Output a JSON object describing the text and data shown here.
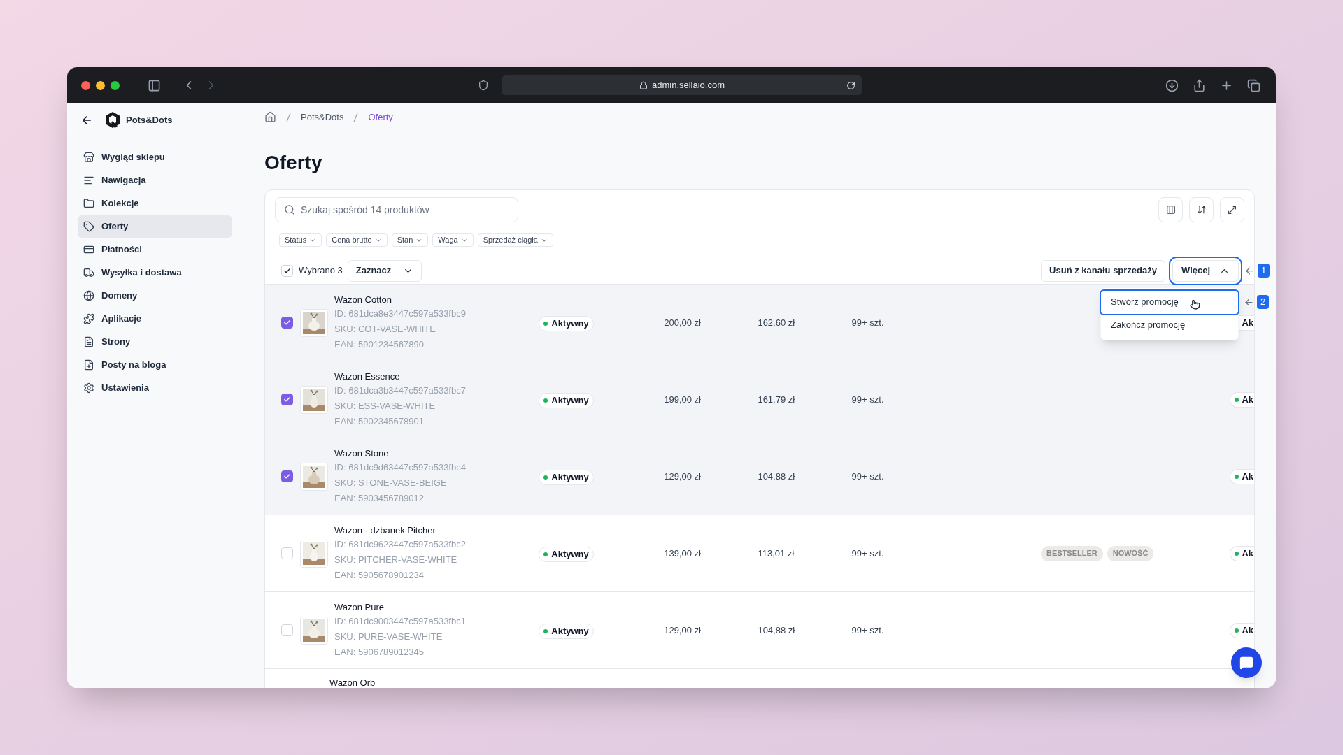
{
  "browser": {
    "url": "admin.sellaio.com"
  },
  "sidebar": {
    "store_name": "Pots&Dots",
    "items": [
      {
        "label": "Wygląd sklepu",
        "selected": false
      },
      {
        "label": "Nawigacja",
        "selected": false
      },
      {
        "label": "Kolekcje",
        "selected": false
      },
      {
        "label": "Oferty",
        "selected": true
      },
      {
        "label": "Płatności",
        "selected": false
      },
      {
        "label": "Wysyłka i dostawa",
        "selected": false
      },
      {
        "label": "Domeny",
        "selected": false
      },
      {
        "label": "Aplikacje",
        "selected": false
      },
      {
        "label": "Strony",
        "selected": false
      },
      {
        "label": "Posty na bloga",
        "selected": false
      },
      {
        "label": "Ustawienia",
        "selected": false
      }
    ]
  },
  "breadcrumb": [
    {
      "label": "Pots&Dots",
      "current": false
    },
    {
      "label": "Oferty",
      "current": true
    }
  ],
  "page_title": "Oferty",
  "search": {
    "placeholder": "Szukaj spośród 14 produktów"
  },
  "filters": [
    "Status",
    "Cena brutto",
    "Stan",
    "Waga",
    "Sprzedaż ciągła"
  ],
  "selection": {
    "checked": true,
    "label": "Wybrano 3",
    "select_menu": "Zaznacz"
  },
  "actions": {
    "remove": "Usuń z kanału sprzedaży",
    "more": {
      "label": "Więcej",
      "expanded": true,
      "highlighted": true,
      "annotation": "1",
      "menu": [
        {
          "label": "Stwórz promocję",
          "highlighted": true,
          "annotation": "2"
        },
        {
          "label": "Zakończ promocję",
          "highlighted": false
        }
      ]
    }
  },
  "rows": [
    {
      "name": "Wazon Cotton",
      "id": "ID: 681dca8e3447c597a533fbc9",
      "sku": "SKU: COT-VASE-WHITE",
      "ean": "EAN: 5901234567890",
      "selected": true,
      "status": "Aktywny",
      "price": "200,00 zł",
      "net_price": "162,60 zł",
      "stock": "99+ szt.",
      "column_8": "Ak"
    },
    {
      "name": "Wazon Essence",
      "id": "ID: 681dca3b3447c597a533fbc7",
      "sku": "SKU: ESS-VASE-WHITE",
      "ean": "EAN: 5902345678901",
      "selected": true,
      "status": "Aktywny",
      "price": "199,00 zł",
      "net_price": "161,79 zł",
      "stock": "99+ szt.",
      "column_8": "Ak"
    },
    {
      "name": "Wazon Stone",
      "id": "ID: 681dc9d63447c597a533fbc4",
      "sku": "SKU: STONE-VASE-BEIGE",
      "ean": "EAN: 5903456789012",
      "selected": true,
      "status": "Aktywny",
      "price": "129,00 zł",
      "net_price": "104,88 zł",
      "stock": "99+ szt.",
      "column_8": "Ak"
    },
    {
      "name": "Wazon - dzbanek Pitcher",
      "id": "ID: 681dc9623447c597a533fbc2",
      "sku": "SKU: PITCHER-VASE-WHITE",
      "ean": "EAN: 5905678901234",
      "selected": false,
      "status": "Aktywny",
      "price": "139,00 zł",
      "net_price": "113,01 zł",
      "stock": "99+ szt.",
      "tags": [
        "BESTSELLER",
        "NOWOŚĆ"
      ],
      "column_8": "Ak"
    },
    {
      "name": "Wazon Pure",
      "id": "ID: 681dc9003447c597a533fbc1",
      "sku": "SKU: PURE-VASE-WHITE",
      "ean": "EAN: 5906789012345",
      "selected": false,
      "status": "Aktywny",
      "price": "129,00 zł",
      "net_price": "104,88 zł",
      "stock": "99+ szt.",
      "column_8": "Ak"
    },
    {
      "name": "Wazon Orb"
    }
  ]
}
